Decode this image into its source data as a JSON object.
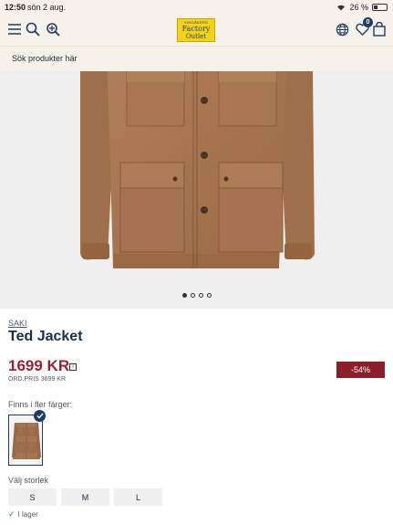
{
  "status_bar": {
    "time": "12:50",
    "date": "sön 2 aug.",
    "battery": "26 %"
  },
  "header": {
    "logo_top": "VINGÅKERS",
    "logo_line1": "Factory",
    "logo_line2": "Outlet",
    "cart_count": "0"
  },
  "search": {
    "placeholder": "Sök produkter här"
  },
  "gallery": {
    "active_index": 0,
    "count": 4
  },
  "product": {
    "brand": "SAKI",
    "name": "Ted Jacket",
    "price": "1699 KR",
    "ord_pris": "ORD.PRIS 3699 KR",
    "discount": "-54%",
    "colors_label": "Finns i fler färger:",
    "size_label": "Välj storlek",
    "sizes": [
      "S",
      "M",
      "L"
    ],
    "stock": "I lager"
  },
  "colors": {
    "jacket": "#a67550",
    "discount_bg": "#8b1e2a",
    "price": "#9b2335",
    "navy": "#1f3b66"
  }
}
